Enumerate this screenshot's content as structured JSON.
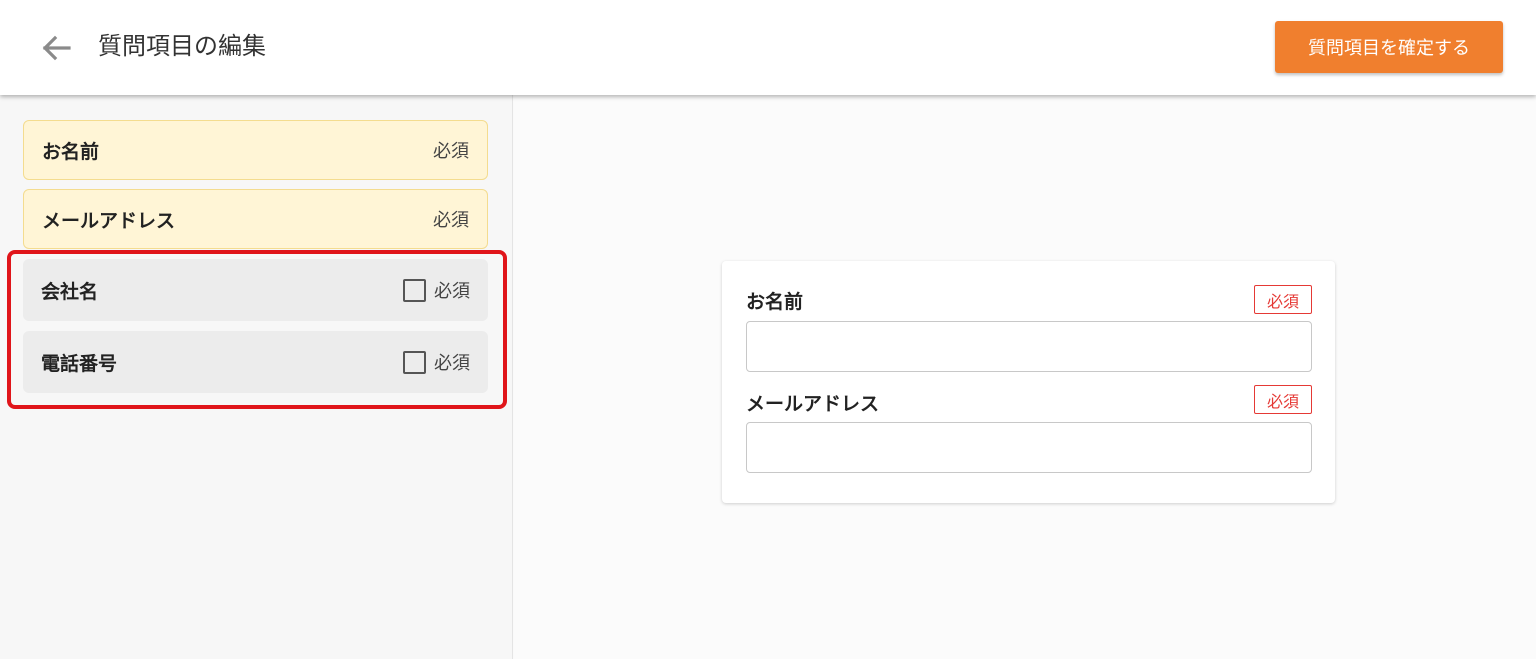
{
  "header": {
    "back_icon": "arrow-left-icon",
    "title": "質問項目の編集",
    "confirm_label": "質問項目を確定する",
    "accent_color": "#f07f2e"
  },
  "sidebar": {
    "fixed_items": [
      {
        "label": "お名前",
        "required": "必須"
      },
      {
        "label": "メールアドレス",
        "required": "必須"
      }
    ],
    "optional_items": [
      {
        "label": "会社名",
        "required_label": "必須",
        "checked": false
      },
      {
        "label": "電話番号",
        "required_label": "必須",
        "checked": false
      }
    ]
  },
  "preview": {
    "fields": [
      {
        "label": "お名前",
        "badge": "必須",
        "value": ""
      },
      {
        "label": "メールアドレス",
        "badge": "必須",
        "value": ""
      }
    ]
  }
}
